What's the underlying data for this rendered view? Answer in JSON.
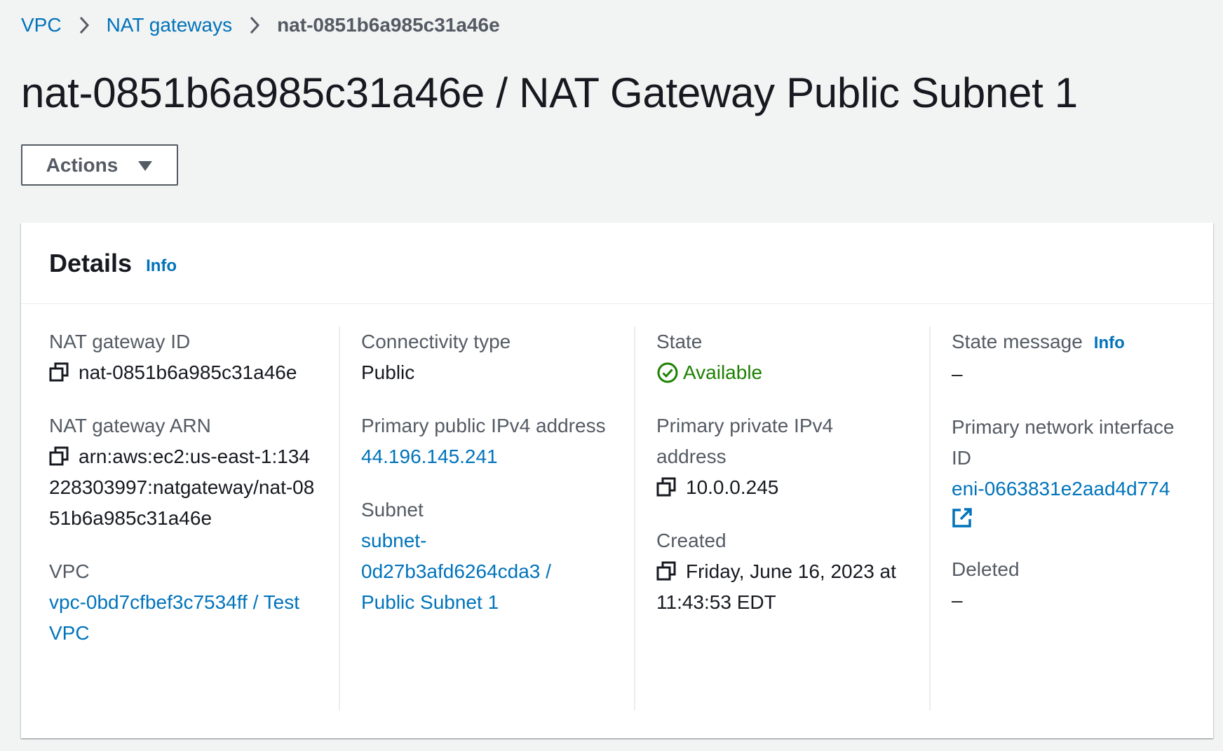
{
  "breadcrumb": {
    "items": [
      {
        "label": "VPC"
      },
      {
        "label": "NAT gateways"
      }
    ],
    "current": "nat-0851b6a985c31a46e"
  },
  "page": {
    "title": "nat-0851b6a985c31a46e / NAT Gateway Public Subnet 1"
  },
  "actions": {
    "label": "Actions"
  },
  "details": {
    "title": "Details",
    "info_label": "Info",
    "nat_gateway_id": {
      "label": "NAT gateway ID",
      "value": "nat-0851b6a985c31a46e"
    },
    "nat_gateway_arn": {
      "label": "NAT gateway ARN",
      "value": "arn:aws:ec2:us-east-1:134228303997:natgateway/nat-0851b6a985c31a46e"
    },
    "vpc": {
      "label": "VPC",
      "value": "vpc-0bd7cfbef3c7534ff / Test VPC"
    },
    "connectivity_type": {
      "label": "Connectivity type",
      "value": "Public"
    },
    "primary_public_ipv4": {
      "label": "Primary public IPv4 address",
      "value": "44.196.145.241"
    },
    "subnet": {
      "label": "Subnet",
      "value": "subnet-0d27b3afd6264cda3 / Public Subnet 1"
    },
    "state": {
      "label": "State",
      "value": "Available",
      "color": "#1d8102"
    },
    "primary_private_ipv4": {
      "label": "Primary private IPv4 address",
      "value": "10.0.0.245"
    },
    "created": {
      "label": "Created",
      "value": "Friday, June 16, 2023 at 11:43:53 EDT"
    },
    "state_message": {
      "label": "State message",
      "info_label": "Info",
      "value": "–"
    },
    "primary_network_interface": {
      "label": "Primary network interface ID",
      "value": "eni-0663831e2aad4d774"
    },
    "deleted": {
      "label": "Deleted",
      "value": "–"
    }
  },
  "colors": {
    "link": "#0073bb",
    "background": "#f2f3f3",
    "success": "#1d8102"
  }
}
